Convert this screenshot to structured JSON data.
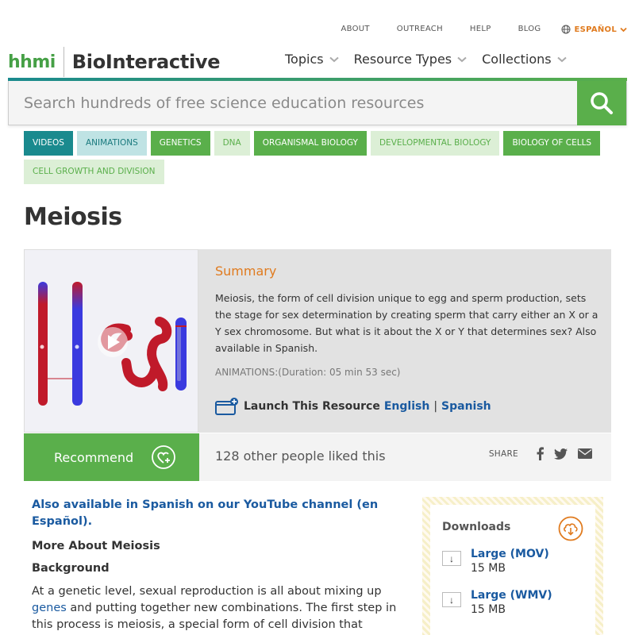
{
  "util_nav": {
    "items": [
      "ABOUT",
      "OUTREACH",
      "HELP",
      "BLOG"
    ],
    "language": "ESPAÑOL"
  },
  "logo": {
    "left": "hhmi",
    "right": "BioInteractive"
  },
  "main_nav": [
    "Topics",
    "Resource Types",
    "Collections"
  ],
  "search": {
    "placeholder": "Search hundreds of free science education resources"
  },
  "tags": [
    {
      "label": "VIDEOS",
      "style": "teal"
    },
    {
      "label": "ANIMATIONS",
      "style": "lteal"
    },
    {
      "label": "GENETICS",
      "style": "green"
    },
    {
      "label": "DNA",
      "style": "lgreen"
    },
    {
      "label": "ORGANISMAL BIOLOGY",
      "style": "green"
    },
    {
      "label": "DEVELOPMENTAL BIOLOGY",
      "style": "lgreen"
    },
    {
      "label": "BIOLOGY OF CELLS",
      "style": "green"
    },
    {
      "label": "CELL GROWTH AND DIVISION",
      "style": "lgreen"
    }
  ],
  "page_title": "Meiosis",
  "summary": {
    "title": "Summary",
    "description": "Meiosis, the form of cell division unique to egg and sperm production, sets the stage for sex determination by creating sperm that carry either an X or a Y sex chromosome. But what is it about the X or Y that determines sex? Also available in Spanish.",
    "meta": "ANIMATIONS:(Duration: 05 min 53 sec)"
  },
  "launch": {
    "label": "Launch This Resource",
    "english": "English",
    "separator": "|",
    "spanish": "Spanish"
  },
  "recommend": {
    "button": "Recommend",
    "likes": "128 other people liked this",
    "share_label": "SHARE"
  },
  "content": {
    "also": "Also available in Spanish on our YouTube channel (en Español).",
    "more_about": "More About Meiosis",
    "background": "Background",
    "para_before": "At a genetic level, sexual reproduction is all about mixing up ",
    "para_link": "genes",
    "para_after": " and putting together new combinations. The first step in this process is meiosis, a special form of cell division that produces"
  },
  "downloads": {
    "title": "Downloads",
    "items": [
      {
        "name": "Large (MOV)",
        "size": "15 MB"
      },
      {
        "name": "Large (WMV)",
        "size": "15 MB"
      }
    ]
  },
  "colors": {
    "teal": "#1a8a8e",
    "green": "#5aaf4b",
    "orange": "#e07b1f",
    "link_blue": "#1a5aa0"
  }
}
